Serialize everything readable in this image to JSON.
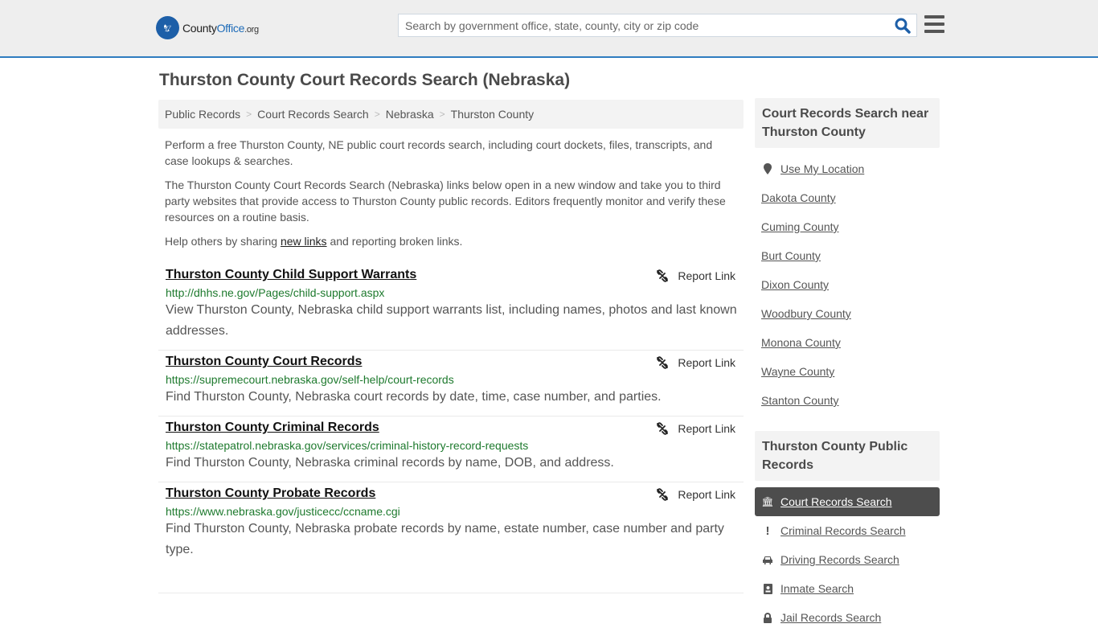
{
  "header": {
    "logo": {
      "name_part1": "County",
      "name_part2": "Office",
      "name_suffix": ".org"
    },
    "search": {
      "placeholder": "Search by government office, state, county, city or zip code",
      "value": ""
    },
    "colors": {
      "brand": "#1d6bb8",
      "accent_line": "#2f7cbf"
    }
  },
  "page": {
    "title": "Thurston County Court Records Search (Nebraska)"
  },
  "breadcrumb": [
    "Public Records",
    "Court Records Search",
    "Nebraska",
    "Thurston County"
  ],
  "intro": {
    "p1": "Perform a free Thurston County, NE public court records search, including court dockets, files, transcripts, and case lookups & searches.",
    "p2": "The Thurston County Court Records Search (Nebraska) links below open in a new window and take you to third party websites that provide access to Thurston County public records. Editors frequently monitor and verify these resources on a routine basis.",
    "p3_before": "Help others by sharing ",
    "p3_link": "new links",
    "p3_after": " and reporting broken links."
  },
  "records": [
    {
      "title": "Thurston County Child Support Warrants",
      "url": "http://dhhs.ne.gov/Pages/child-support.aspx",
      "description": "View Thurston County, Nebraska child support warrants list, including names, photos and last known addresses.",
      "report_label": "Report Link"
    },
    {
      "title": "Thurston County Court Records",
      "url": "https://supremecourt.nebraska.gov/self-help/court-records",
      "description": "Find Thurston County, Nebraska court records by date, time, case number, and parties.",
      "report_label": "Report Link"
    },
    {
      "title": "Thurston County Criminal Records",
      "url": "https://statepatrol.nebraska.gov/services/criminal-history-record-requests",
      "description": "Find Thurston County, Nebraska criminal records by name, DOB, and address.",
      "report_label": "Report Link"
    },
    {
      "title": "Thurston County Probate Records",
      "url": "https://www.nebraska.gov/justicecc/ccname.cgi",
      "description": "Find Thurston County, Nebraska probate records by name, estate number, case number and party type.",
      "report_label": "Report Link"
    }
  ],
  "sidebar": {
    "nearby": {
      "heading": "Court Records Search near Thurston County",
      "use_location": "Use My Location",
      "counties": [
        "Dakota County",
        "Cuming County",
        "Burt County",
        "Dixon County",
        "Woodbury County",
        "Monona County",
        "Wayne County",
        "Stanton County"
      ]
    },
    "public_records": {
      "heading": "Thurston County Public Records",
      "items": [
        {
          "label": "Court Records Search",
          "icon": "courthouse-icon",
          "active": true
        },
        {
          "label": "Criminal Records Search",
          "icon": "exclamation-icon",
          "active": false
        },
        {
          "label": "Driving Records Search",
          "icon": "car-icon",
          "active": false
        },
        {
          "label": "Inmate Search",
          "icon": "id-badge-icon",
          "active": false
        },
        {
          "label": "Jail Records Search",
          "icon": "lock-icon",
          "active": false
        }
      ]
    }
  }
}
